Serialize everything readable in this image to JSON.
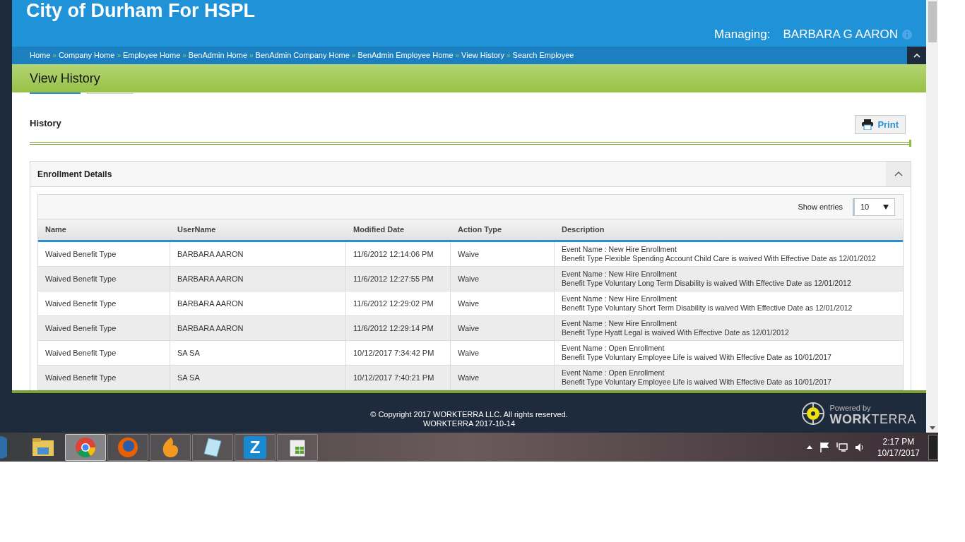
{
  "header": {
    "title": "City of Durham For HSPL",
    "managing_label": "Managing:",
    "managing_name": "BARBARA G AARON"
  },
  "breadcrumb": [
    {
      "label": "Home"
    },
    {
      "separator": "»",
      "label": "Company Home"
    },
    {
      "separator": "»",
      "label": "Employee Home"
    },
    {
      "separator": "»",
      "label": "BenAdmin Home"
    },
    {
      "separator": "»",
      "label": "BenAdmin Company Home"
    },
    {
      "separator": "»",
      "label": "BenAdmin Employee Home"
    },
    {
      "separator": "»",
      "label": "View History"
    },
    {
      "separator": "»",
      "label": "Search Employee"
    }
  ],
  "page_title": "View History",
  "tabs": [
    {
      "selected": true
    },
    {
      "selected": false
    }
  ],
  "section": {
    "title": "History",
    "print_button": "Print"
  },
  "panel": {
    "title": "Enrollment Details",
    "expanded": true,
    "show_entries_label": "Show entries",
    "show_entries_value": "10"
  },
  "table": {
    "columns": [
      "Name",
      "UserName",
      "Modified Date",
      "Action Type",
      "Description"
    ],
    "rows": [
      {
        "name": "Waived Benefit Type",
        "username": "BARBARA AARON",
        "modified": "11/6/2012 12:14:06 PM",
        "action": "Waive",
        "description": [
          "Event Name : New Hire Enrollment",
          "Benefit Type Flexible Spending Account Child Care is waived With Effective Date as 12/01/2012"
        ]
      },
      {
        "name": "Waived Benefit Type",
        "username": "BARBARA AARON",
        "modified": "11/6/2012 12:27:55 PM",
        "action": "Waive",
        "description": [
          "Event Name : New Hire Enrollment",
          "Benefit Type Voluntary Long Term Disability is waived With Effective Date as 12/01/2012"
        ]
      },
      {
        "name": "Waived Benefit Type",
        "username": "BARBARA AARON",
        "modified": "11/6/2012 12:29:02 PM",
        "action": "Waive",
        "description": [
          "Event Name : New Hire Enrollment",
          "Benefit Type Voluntary Short Term Disability is waived With Effective Date as 12/01/2012"
        ]
      },
      {
        "name": "Waived Benefit Type",
        "username": "BARBARA AARON",
        "modified": "11/6/2012 12:29:14 PM",
        "action": "Waive",
        "description": [
          "Event Name : New Hire Enrollment",
          "Benefit Type Hyatt Legal is waived With Effective Date as 12/01/2012"
        ]
      },
      {
        "name": "Waived Benefit Type",
        "username": "SA SA",
        "modified": "10/12/2017 7:34:42 PM",
        "action": "Waive",
        "description": [
          "Event Name : Open Enrollment",
          "Benefit Type Voluntary Employee Life is waived With Effective Date as 10/01/2017"
        ]
      },
      {
        "name": "Waived Benefit Type",
        "username": "SA SA",
        "modified": "10/12/2017 7:40:21 PM",
        "action": "Waive",
        "description": [
          "Event Name : Open Enrollment",
          "Benefit Type Voluntary Employee Life is waived With Effective Date as 10/01/2017"
        ]
      }
    ]
  },
  "footer": {
    "copyright": "© Copyright 2017 WORKTERRA LLC. All rights reserved.",
    "version": "WORKTERRA 2017-10-14",
    "powered_by": "Powered by",
    "brand": "**WORK**TERRA"
  },
  "taskbar": {
    "apps": [
      {
        "kind": "folder",
        "selected": false
      },
      {
        "kind": "chrome",
        "selected": true
      },
      {
        "kind": "firefox",
        "selected": false
      },
      {
        "kind": "flame",
        "selected": false
      },
      {
        "kind": "notepad",
        "selected": false
      },
      {
        "kind": "z",
        "selected": false
      },
      {
        "kind": "spreadsheet",
        "selected": false
      }
    ],
    "z_letter": "Z",
    "time": "2:17 PM",
    "date": "10/17/2017"
  }
}
